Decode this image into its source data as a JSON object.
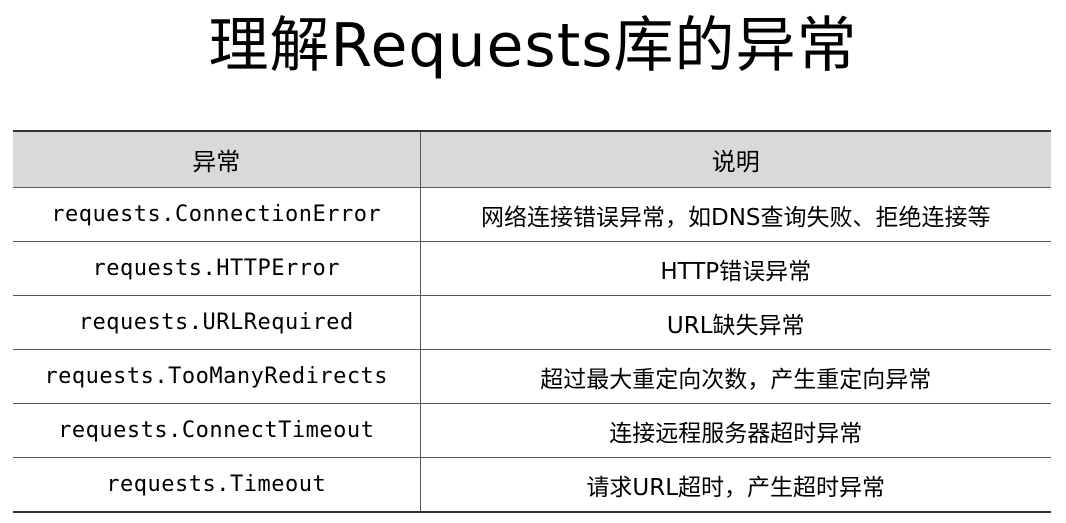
{
  "title": "理解Requests库的异常",
  "table": {
    "headers": {
      "exception": "异常",
      "description": "说明"
    },
    "rows": [
      {
        "exception": "requests.ConnectionError",
        "description": "网络连接错误异常，如DNS查询失败、拒绝连接等"
      },
      {
        "exception": "requests.HTTPError",
        "description": "HTTP错误异常"
      },
      {
        "exception": "requests.URLRequired",
        "description": "URL缺失异常"
      },
      {
        "exception": "requests.TooManyRedirects",
        "description": "超过最大重定向次数，产生重定向异常"
      },
      {
        "exception": "requests.ConnectTimeout",
        "description": "连接远程服务器超时异常"
      },
      {
        "exception": "requests.Timeout",
        "description": "请求URL超时，产生超时异常"
      }
    ]
  }
}
